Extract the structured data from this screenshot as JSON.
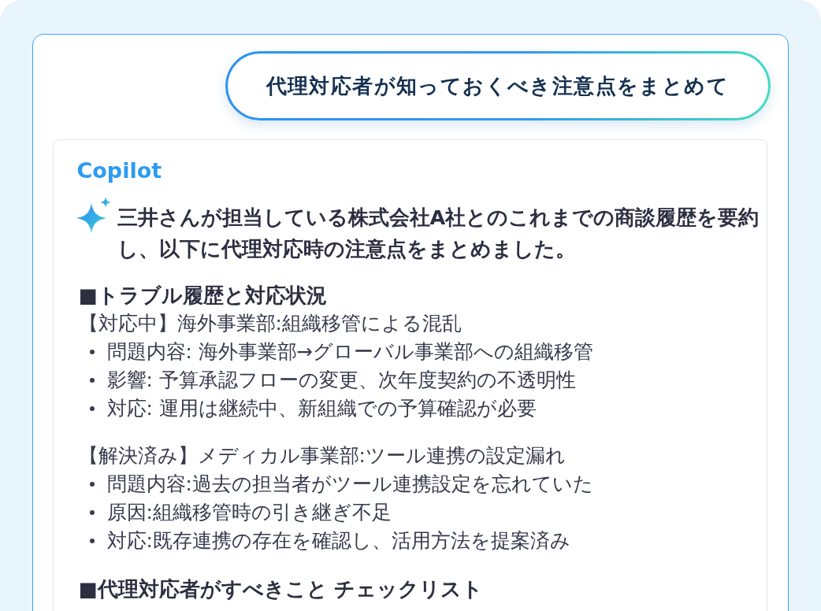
{
  "user_message": {
    "text": "代理対応者が知っておくべき注意点をまとめて"
  },
  "response": {
    "sender": "Copilot",
    "summary": "三井さんが担当している株式会社A社とのこれまでの商談履歴を要約し、以下に代理対応時の注意点をまとめました。",
    "sections": [
      {
        "heading": "■トラブル履歴と対応状況",
        "issues": [
          {
            "title": "【対応中】海外事業部:組織移管による混乱",
            "bullets": [
              "問題内容: 海外事業部→グローバル事業部への組織移管",
              "影響: 予算承認フローの変更、次年度契約の不透明性",
              "対応: 運用は継続中、新組織での予算確認が必要"
            ]
          },
          {
            "title": "【解決済み】メディカル事業部:ツール連携の設定漏れ",
            "bullets": [
              "問題内容:過去の担当者がツール連携設定を忘れていた",
              "原因:組織移管時の引き継ぎ不足",
              "対応:既存連携の存在を確認し、活用方法を提案済み"
            ]
          }
        ]
      },
      {
        "heading": "■代理対応者がすべきこと チェックリスト"
      }
    ]
  }
}
